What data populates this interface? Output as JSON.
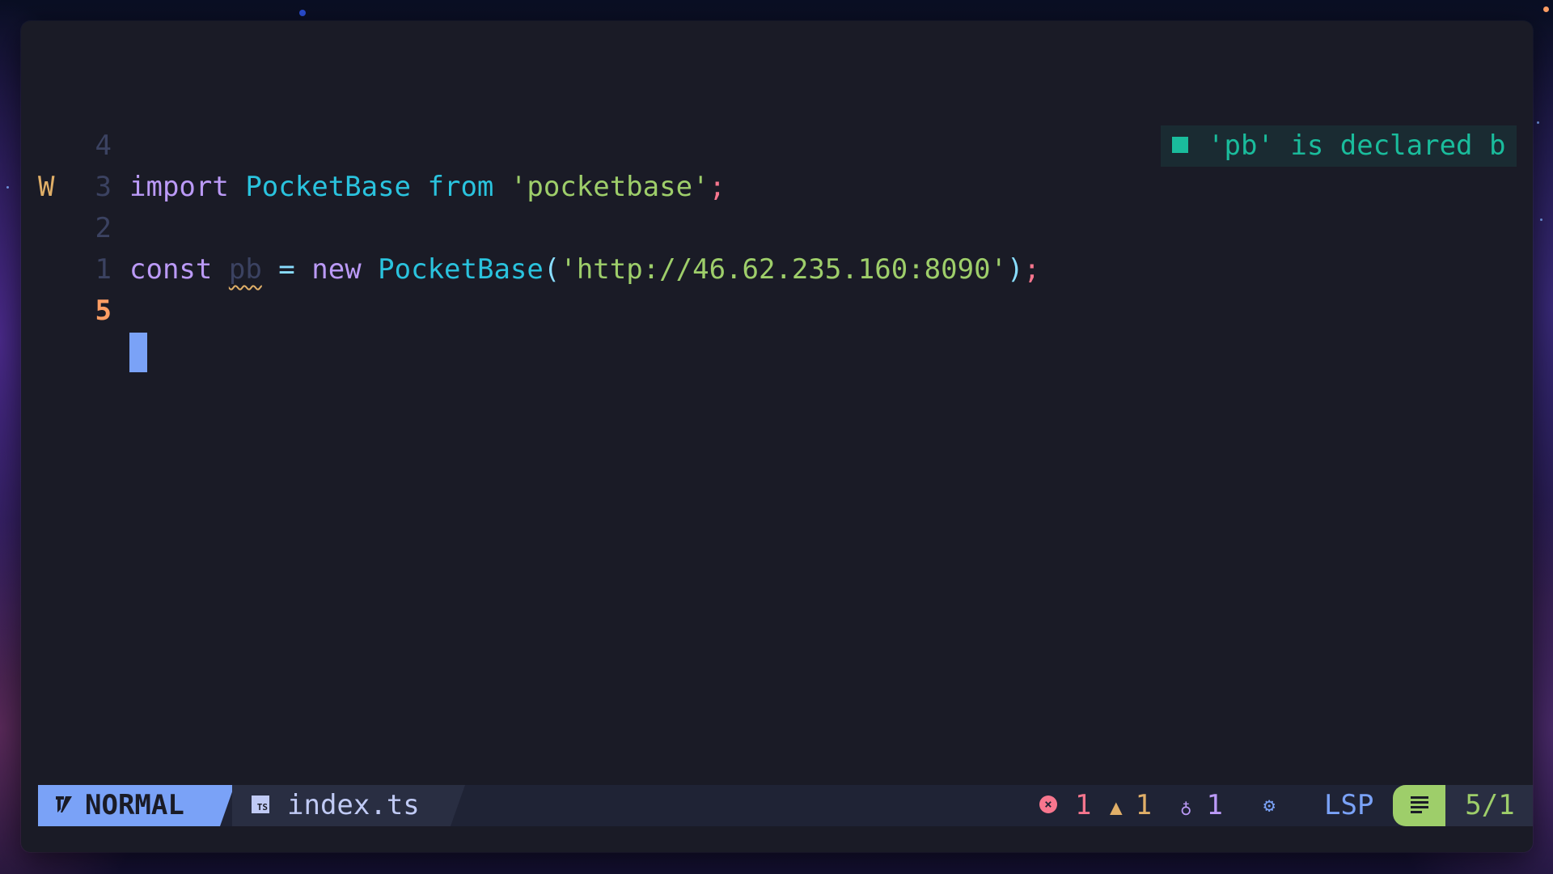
{
  "editor": {
    "lines": [
      {
        "sign": "",
        "number": "4",
        "tokens": [
          {
            "text": "import",
            "cls": "kw"
          },
          {
            "text": " ",
            "cls": "plain"
          },
          {
            "text": "PocketBase",
            "cls": "fn"
          },
          {
            "text": " ",
            "cls": "plain"
          },
          {
            "text": "from",
            "cls": "fn"
          },
          {
            "text": " ",
            "cls": "plain"
          },
          {
            "text": "'pocketbase'",
            "cls": "str"
          },
          {
            "text": ";",
            "cls": "pun"
          }
        ]
      },
      {
        "sign": "",
        "number": "3",
        "tokens": []
      },
      {
        "sign": "W",
        "number": "2",
        "tokens": [
          {
            "text": "const",
            "cls": "kw"
          },
          {
            "text": " ",
            "cls": "plain"
          },
          {
            "text": "pb",
            "cls": "unused"
          },
          {
            "text": " ",
            "cls": "plain"
          },
          {
            "text": "=",
            "cls": "op"
          },
          {
            "text": " ",
            "cls": "plain"
          },
          {
            "text": "new",
            "cls": "kw"
          },
          {
            "text": " ",
            "cls": "plain"
          },
          {
            "text": "PocketBase",
            "cls": "fn"
          },
          {
            "text": "(",
            "cls": "op"
          },
          {
            "text": "'http://46.62.235.160:8090'",
            "cls": "str"
          },
          {
            "text": ")",
            "cls": "op"
          },
          {
            "text": ";",
            "cls": "pun"
          }
        ]
      },
      {
        "sign": "",
        "number": "1",
        "tokens": []
      },
      {
        "sign": "",
        "number": "5",
        "tokens": [],
        "current": true
      }
    ],
    "diagnostic": "'pb' is declared b"
  },
  "statusline": {
    "mode": "NORMAL",
    "file_icon_label": "TS",
    "filename": "index.ts",
    "errors": "1",
    "warnings": "1",
    "hints": "1",
    "lsp_label": "LSP",
    "position": "5/1"
  },
  "colors": {
    "background": "#1a1b26",
    "mode_bg": "#7aa2f7",
    "error": "#f7768e",
    "warning": "#e0af68",
    "hint": "#bb9af7",
    "string": "#9ece6a",
    "diagnostic": "#1abc9c"
  }
}
